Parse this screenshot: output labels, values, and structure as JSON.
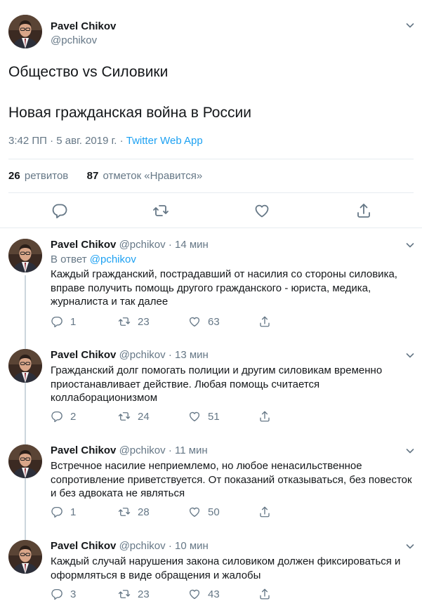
{
  "main_tweet": {
    "author_name": "Pavel Chikov",
    "author_handle": "@pchikov",
    "text_line1": "Общество vs Силовики",
    "text_line2": "Новая гражданская война в России",
    "time": "3:42 ПП",
    "date": "5 авг. 2019 г.",
    "separator": "·",
    "source_app": "Twitter Web App",
    "retweets_count": "26",
    "retweets_label": "ретвитов",
    "likes_count": "87",
    "likes_label": "отметок «Нравится»"
  },
  "replies": [
    {
      "author_name": "Pavel Chikov",
      "author_handle": "@pchikov",
      "time": "14 мин",
      "in_reply_prefix": "В ответ",
      "in_reply_handle": "@pchikov",
      "text": "Каждый гражданский, пострадавший от насилия со стороны силовика, вправе получить помощь другого гражданского - юриста, медика, журналиста и так далее",
      "replies": "1",
      "retweets": "23",
      "likes": "63"
    },
    {
      "author_name": "Pavel Chikov",
      "author_handle": "@pchikov",
      "time": "13 мин",
      "text": "Гражданский долг помогать полиции и другим силовикам временно приостанавливает действие. Любая помощь считается коллаборационизмом",
      "replies": "2",
      "retweets": "24",
      "likes": "51"
    },
    {
      "author_name": "Pavel Chikov",
      "author_handle": "@pchikov",
      "time": "11 мин",
      "text": "Встречное насилие неприемлемо, но любое ненасильственное сопротивление приветствуется. От показаний отказываться, без повесток и без адвоката не являться",
      "replies": "1",
      "retweets": "28",
      "likes": "50"
    },
    {
      "author_name": "Pavel Chikov",
      "author_handle": "@pchikov",
      "time": "10 мин",
      "text": "Каждый случай нарушения закона силовиком должен фиксироваться и оформляться в виде обращения и жалобы",
      "replies": "3",
      "retweets": "23",
      "likes": "43"
    }
  ],
  "icons": {
    "reply": "reply-icon",
    "retweet": "retweet-icon",
    "like": "heart-icon",
    "share": "share-icon",
    "menu": "chevron-down-icon"
  },
  "colors": {
    "accent": "#1da1f2",
    "text": "#14171a",
    "muted": "#657786",
    "border": "#e6ecf0",
    "thread_line": "#ccd6dd"
  }
}
